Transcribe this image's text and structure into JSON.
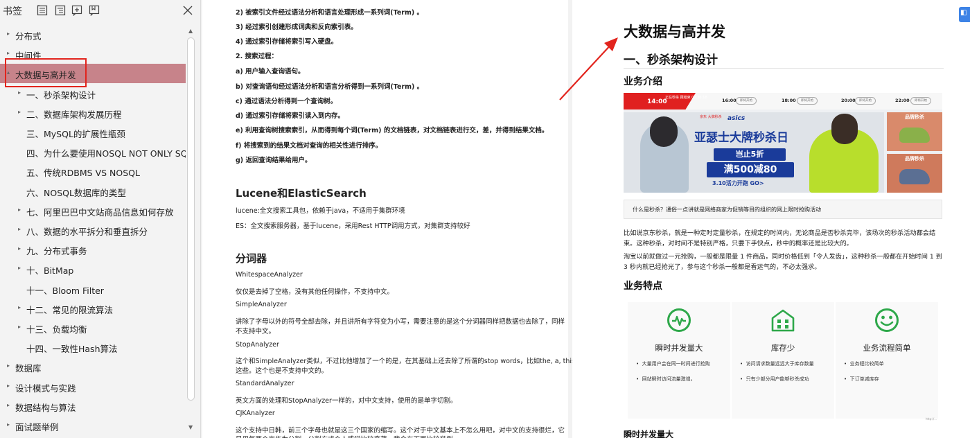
{
  "sidebar": {
    "title": "书签",
    "toolbar_icons": [
      "expand-all-icon",
      "collapse-all-icon",
      "add-bookmark-icon",
      "bookmark-properties-icon"
    ],
    "close_icon": "close-icon",
    "items": [
      {
        "label": "分布式",
        "level": 0,
        "arrow": "▸"
      },
      {
        "label": "中间件",
        "level": 0,
        "arrow": "▸"
      },
      {
        "label": "大数据与高并发",
        "level": 0,
        "arrow": "▴",
        "selected": true
      },
      {
        "label": "一、秒杀架构设计",
        "level": 1,
        "arrow": "▸"
      },
      {
        "label": "二、数据库架构发展历程",
        "level": 1,
        "arrow": "▸"
      },
      {
        "label": "三、MySQL的扩展性瓶颈",
        "level": 1,
        "arrow": ""
      },
      {
        "label": "四、为什么要使用NOSQL   NOT ONLY SQL",
        "level": 1,
        "arrow": ""
      },
      {
        "label": "五、传统RDBMS VS NOSQL",
        "level": 1,
        "arrow": ""
      },
      {
        "label": "六、NOSQL数据库的类型",
        "level": 1,
        "arrow": ""
      },
      {
        "label": "七、阿里巴巴中文站商品信息如何存放",
        "level": 1,
        "arrow": "▸"
      },
      {
        "label": "八、数据的水平拆分和垂直拆分",
        "level": 1,
        "arrow": "▸"
      },
      {
        "label": "九、分布式事务",
        "level": 1,
        "arrow": "▸"
      },
      {
        "label": "十、BitMap",
        "level": 1,
        "arrow": "▸"
      },
      {
        "label": "十一、Bloom Filter",
        "level": 1,
        "arrow": ""
      },
      {
        "label": "十二、常见的限流算法",
        "level": 1,
        "arrow": "▸"
      },
      {
        "label": "十三、负载均衡",
        "level": 1,
        "arrow": "▸"
      },
      {
        "label": "十四、一致性Hash算法",
        "level": 1,
        "arrow": ""
      },
      {
        "label": "数据库",
        "level": 0,
        "arrow": "▸"
      },
      {
        "label": "设计模式与实践",
        "level": 0,
        "arrow": "▸"
      },
      {
        "label": "数据结构与算法",
        "level": 0,
        "arrow": "▸"
      },
      {
        "label": "面试题举例",
        "level": 0,
        "arrow": "▸"
      }
    ]
  },
  "left_page": {
    "lines": [
      {
        "text": "2) 被索引文件经过语法分析和语言处理形成一系列词(Term) 。",
        "style": "bold"
      },
      {
        "text": "3) 经过索引创建形成词典和反向索引表。",
        "style": "bold"
      },
      {
        "text": "4) 通过索引存储将索引写入硬盘。",
        "style": "bold"
      },
      {
        "text": "2. 搜索过程：",
        "style": "bold"
      },
      {
        "text": "a) 用户输入查询语句。",
        "style": "bold"
      },
      {
        "text": "b) 对查询语句经过语法分析和语言分析得到一系列词(Term) 。",
        "style": "bold"
      },
      {
        "text": "c) 通过语法分析得到一个查询树。",
        "style": "bold"
      },
      {
        "text": "d) 通过索引存储将索引读入到内存。",
        "style": "bold"
      },
      {
        "text": "e) 利用查询树搜索索引，从而得到每个词(Term) 的文档链表，对文档链表进行交，差，并得到结果文档。",
        "style": "bold"
      },
      {
        "text": "f) 将搜索到的结果文档对查询的相关性进行排序。",
        "style": "bold"
      },
      {
        "text": "g) 返回查询结果给用户。",
        "style": "bold"
      },
      {
        "text": "Lucene和ElasticSearch",
        "style": "h2"
      },
      {
        "text": "lucene:全文搜索工具包，依赖于java，不适用于集群环境",
        "style": "text"
      },
      {
        "text": "ES：全文搜索服务器，基于lucene，采用Rest HTTP调用方式，对集群支持较好",
        "style": "text"
      },
      {
        "text": "分词器",
        "style": "h2"
      },
      {
        "text": "WhitespaceAnalyzer",
        "style": "text"
      },
      {
        "text": "仅仅是去掉了空格，没有其他任何操作，不支持中文。",
        "style": "text"
      },
      {
        "text": "SimpleAnalyzer",
        "style": "text"
      },
      {
        "text": "讲除了字母以外的符号全部去除，并且讲所有字符变为小写，需要注意的是这个分词器同样把数据也去除了，同样",
        "style": "text"
      },
      {
        "text": "不支持中文。",
        "style": "text"
      },
      {
        "text": "StopAnalyzer",
        "style": "text"
      },
      {
        "text": "这个和SimpleAnalyzer类似，不过比他增加了一个的是，在其基础上还去除了所谓的stop words，比如the, a, this",
        "style": "text"
      },
      {
        "text": "这些。这个也是不支持中文的。",
        "style": "text"
      },
      {
        "text": "StandardAnalyzer",
        "style": "text"
      },
      {
        "text": "英文方面的处理和StopAnalyzer一样的，对中文支持，使用的是单字切割。",
        "style": "text"
      },
      {
        "text": "CJKAnalyzer",
        "style": "text"
      },
      {
        "text": "这个支持中日韩，前三个字母也就是这三个国家的缩写。这个对于中文基本上不怎么用吧，对中文的支持很烂，它",
        "style": "text"
      },
      {
        "text": "是用每两个字作为分割，分割方式个人感觉比较奇葩，我会在下面比较举例。",
        "style": "text"
      }
    ]
  },
  "right_page": {
    "title": "大数据与高并发",
    "h1": "一、秒杀架构设计",
    "h2_intro": "业务介绍",
    "banner": {
      "flag_time": "14:00",
      "flag_tag": "正在秒杀 距结束 00:36:18",
      "slots": [
        {
          "time": "16:00",
          "pill": "即将开始"
        },
        {
          "time": "18:00",
          "pill": "即将开始"
        },
        {
          "time": "20:00",
          "pill": "即将开始"
        },
        {
          "time": "22:00",
          "pill": "即将开始"
        }
      ],
      "brand": "asics",
      "tag": "京东 大牌秒杀",
      "slogan": "亚瑟士大牌秒杀日",
      "discount": "岂止5折",
      "deal": "满500减80",
      "date": "3.10活力开跑 GO>",
      "side_titles": [
        "品牌秒杀",
        "品牌秒杀"
      ]
    },
    "callout": "什么是秒杀？通俗一点讲就是网络商家为促销等目的组织的网上限时抢购活动",
    "para1": "比如说京东秒杀，就是一种定时定量秒杀，在规定的时间内，无论商品是否秒杀完毕，该场次的秒杀活动都会结束。这种秒杀，对时间不是特别严格，只要下手快点，秒中的概率还是比较大的。",
    "para2": "淘宝以前就做过一元抢购，一般都是限量 1 件商品，同时价格低到「令人发齿」，这种秒杀一般都在开始时间 1 到 3 秒内就已经抢光了，参与这个秒杀一般都是看运气的，不必太强求。",
    "h2_features": "业务特点",
    "features": [
      {
        "icon": "pulse-icon",
        "title": "瞬时并发量大",
        "bullets": [
          "大量用户会在同一时间进行抢购",
          "网站瞬时访问流量激增。"
        ]
      },
      {
        "icon": "warehouse-icon",
        "title": "库存少",
        "bullets": [
          "访问请求数量远远大于库存数量",
          "只有少部分用户能够秒杀成功"
        ]
      },
      {
        "icon": "smile-icon",
        "title": "业务流程简单",
        "bullets": [
          "业务程比较简单",
          "下订单减库存"
        ]
      }
    ],
    "credit": "http://…",
    "h2_bottom": "瞬时并发量大"
  },
  "colors": {
    "selected_bg": "#c7838a",
    "highlight_border": "#e2241d",
    "arrow": "#e2241d",
    "feature_green": "#2ea84a",
    "banner_blue": "#1a3b9a",
    "badge_blue": "#3d83e6"
  }
}
